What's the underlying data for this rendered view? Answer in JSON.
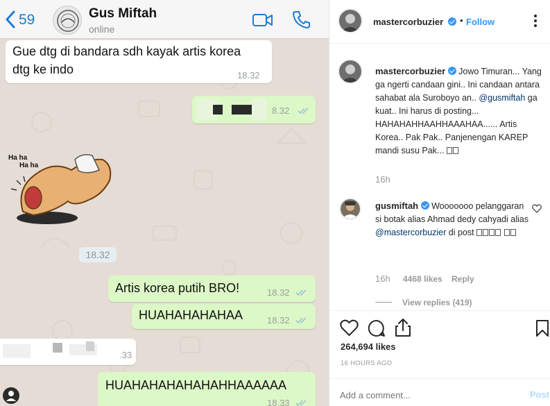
{
  "whatsapp": {
    "header": {
      "back_count": "59",
      "contact_name": "Gus Miftah",
      "status": "online"
    },
    "messages": [
      {
        "line1": "Gue dtg di bandara sdh kayak artis korea",
        "line2": "dtg ke indo",
        "time": "18.32"
      },
      {
        "time": "8.32"
      },
      {
        "sticker_text_1": "Ha ha",
        "sticker_text_2": "Ha ha"
      },
      {
        "date_chip": "18.32"
      },
      {
        "text": "Artis korea putih BRO!",
        "time": "18.32"
      },
      {
        "text": "HUAHAHAHAHAA",
        "time": "18.32"
      },
      {
        "time": ".33"
      },
      {
        "text": "HUAHAHAHAHAHAHHAAAAAA",
        "time": "18.33"
      }
    ],
    "colors": {
      "chat_bg": "#e5ddd5",
      "outgoing": "#dcf8c6",
      "incoming": "#ffffff",
      "accent": "#1b7bd8"
    }
  },
  "instagram": {
    "header": {
      "username": "mastercorbuzier",
      "separator": "•",
      "follow_label": "Follow",
      "more_icon": "more-icon"
    },
    "caption": {
      "username": "mastercorbuzier",
      "text_before": " Jowo Timuran... Yang ga ngerti candaan gini.. Ini candaan antara sahabat ala Suroboyo an.. ",
      "mention": "@gusmiftah",
      "text_after": " ga kuat.. Ini harus di posting... HAHAHAHHAAHHAAAHAA...... Artis Korea.. Pak Pak.. Panjenengan KAREP mandi susu Pak... ",
      "time": "16h"
    },
    "comment": {
      "username": "gusmiftah",
      "text_before": " Wooooooo pelanggaran si botak alias Ahmad dedy cahyadi alias ",
      "mention": "@mastercorbuzier",
      "text_after": " di post ",
      "time": "16h",
      "likes": "4468 likes",
      "reply_label": "Reply",
      "view_replies": "View replies (419)"
    },
    "likes": "264,694 likes",
    "time_ago": "16 HOURS AGO",
    "add_comment_placeholder": "Add a comment...",
    "post_label": "Post",
    "colors": {
      "link": "#3897f0",
      "verified": "#3897f0",
      "mention": "#003569"
    }
  }
}
